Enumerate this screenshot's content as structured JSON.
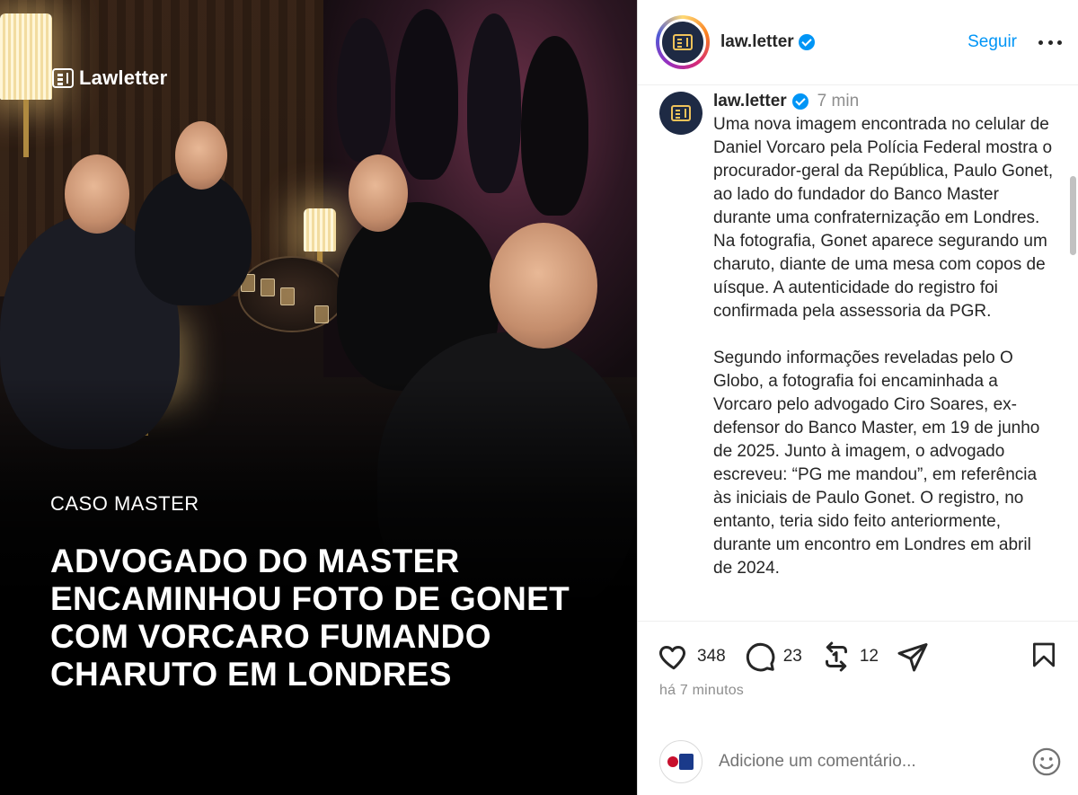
{
  "post_image": {
    "brand": "Lawletter",
    "kicker": "CASO MASTER",
    "headline_lines": [
      "ADVOGADO DO MASTER",
      "ENCAMINHOU FOTO DE GONET",
      "COM VORCARO FUMANDO",
      "CHARUTO EM LONDRES"
    ]
  },
  "header": {
    "username": "law.letter",
    "follow_label": "Seguir",
    "verified": true
  },
  "caption": {
    "username": "law.letter",
    "time": "7 min",
    "paragraphs": [
      "Uma nova imagem encontrada no celular de Daniel Vorcaro pela Polícia Federal mostra o procurador-geral da República, Paulo Gonet, ao lado do fundador do Banco Master durante uma confraternização em Londres. Na fotografia, Gonet aparece segurando um charuto, diante de uma mesa com copos de uísque. A autenticidade do registro foi confirmada pela assessoria da PGR.",
      "Segundo informações reveladas pelo O Globo, a fotografia foi encaminhada a Vorcaro pelo advogado Ciro Soares, ex-defensor do Banco Master, em 19 de junho de 2025. Junto à imagem, o advogado escreveu: “PG me mandou”, em referência às iniciais de Paulo Gonet. O registro, no entanto, teria sido feito anteriormente, durante um encontro em Londres em abril de 2024."
    ]
  },
  "actions": {
    "likes": "348",
    "comments": "23",
    "reposts": "12"
  },
  "post_time": "há 7 minutos",
  "comment_box": {
    "placeholder": "Adicione um comentário..."
  },
  "icons": {
    "verified": "verified-badge-icon",
    "like": "heart-icon",
    "comment": "comment-bubble-icon",
    "repost": "repost-icon",
    "share": "paper-plane-icon",
    "save": "bookmark-icon",
    "emoji": "smiley-icon",
    "more": "more-options-icon"
  },
  "colors": {
    "link_blue": "#0095f6",
    "text": "#262626",
    "muted": "#8e8e8e"
  }
}
